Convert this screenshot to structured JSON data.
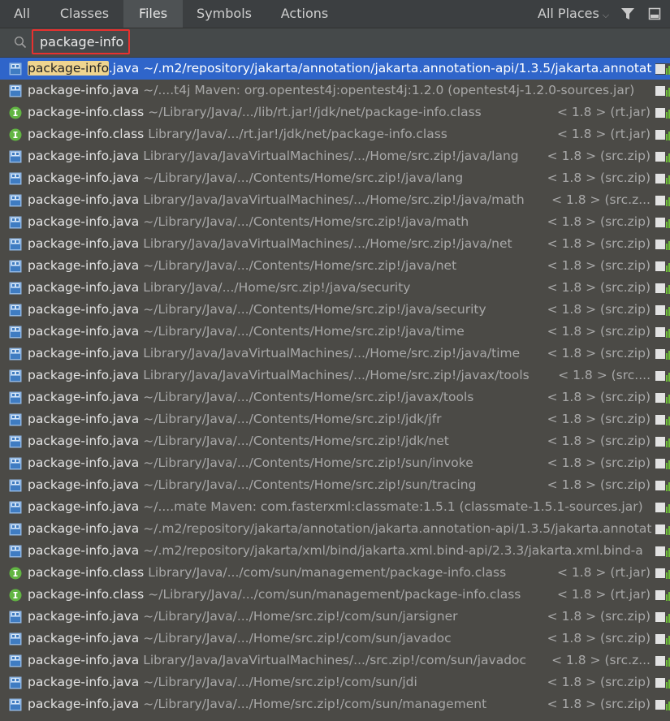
{
  "tabs": [
    {
      "label": "All"
    },
    {
      "label": "Classes"
    },
    {
      "label": "Files"
    },
    {
      "label": "Symbols"
    },
    {
      "label": "Actions"
    }
  ],
  "active_tab": "Files",
  "places": {
    "label": "All Places"
  },
  "search": {
    "value": "package-info"
  },
  "colors": {
    "selection": "#2f65ca",
    "highlight": "#efd48f",
    "search_border": "#e8312f"
  },
  "results": [
    {
      "icon": "java",
      "highlight": "package-info",
      "rest": ".java",
      "path": "~/.m2/repository/jakarta/annotation/jakarta.annotation-api/1.3.5/jakarta.annotat",
      "meta": "",
      "selected": true
    },
    {
      "icon": "java",
      "highlight": "",
      "rest": "package-info.java",
      "path": "~/....t4j   Maven: org.opentest4j:opentest4j:1.2.0 (opentest4j-1.2.0-sources.jar)",
      "meta": ""
    },
    {
      "icon": "class",
      "highlight": "",
      "rest": "package-info.class",
      "path": "~/Library/Java/.../lib/rt.jar!/jdk/net/package-info.class",
      "meta": "< 1.8 > (rt.jar)"
    },
    {
      "icon": "class",
      "highlight": "",
      "rest": "package-info.class",
      "path": "Library/Java/.../rt.jar!/jdk/net/package-info.class",
      "meta": "< 1.8 > (rt.jar)"
    },
    {
      "icon": "java",
      "highlight": "",
      "rest": "package-info.java",
      "path": "Library/Java/JavaVirtualMachines/.../Home/src.zip!/java/lang",
      "meta": "< 1.8 > (src.zip)"
    },
    {
      "icon": "java",
      "highlight": "",
      "rest": "package-info.java",
      "path": "~/Library/Java/.../Contents/Home/src.zip!/java/lang",
      "meta": "< 1.8 > (src.zip)"
    },
    {
      "icon": "java",
      "highlight": "",
      "rest": "package-info.java",
      "path": "Library/Java/JavaVirtualMachines/.../Home/src.zip!/java/math",
      "meta": "< 1.8 > (src.z..."
    },
    {
      "icon": "java",
      "highlight": "",
      "rest": "package-info.java",
      "path": "~/Library/Java/.../Contents/Home/src.zip!/java/math",
      "meta": "< 1.8 > (src.zip)"
    },
    {
      "icon": "java",
      "highlight": "",
      "rest": "package-info.java",
      "path": "Library/Java/JavaVirtualMachines/.../Home/src.zip!/java/net",
      "meta": "< 1.8 > (src.zip)"
    },
    {
      "icon": "java",
      "highlight": "",
      "rest": "package-info.java",
      "path": "~/Library/Java/.../Contents/Home/src.zip!/java/net",
      "meta": "< 1.8 > (src.zip)"
    },
    {
      "icon": "java",
      "highlight": "",
      "rest": "package-info.java",
      "path": "Library/Java/.../Home/src.zip!/java/security",
      "meta": "< 1.8 > (src.zip)"
    },
    {
      "icon": "java",
      "highlight": "",
      "rest": "package-info.java",
      "path": "~/Library/Java/.../Contents/Home/src.zip!/java/security",
      "meta": "< 1.8 > (src.zip)"
    },
    {
      "icon": "java",
      "highlight": "",
      "rest": "package-info.java",
      "path": "~/Library/Java/.../Contents/Home/src.zip!/java/time",
      "meta": "< 1.8 > (src.zip)"
    },
    {
      "icon": "java",
      "highlight": "",
      "rest": "package-info.java",
      "path": "Library/Java/JavaVirtualMachines/.../Home/src.zip!/java/time",
      "meta": "< 1.8 > (src.zip)"
    },
    {
      "icon": "java",
      "highlight": "",
      "rest": "package-info.java",
      "path": "Library/Java/JavaVirtualMachines/.../Home/src.zip!/javax/tools",
      "meta": "< 1.8 > (src...."
    },
    {
      "icon": "java",
      "highlight": "",
      "rest": "package-info.java",
      "path": "~/Library/Java/.../Contents/Home/src.zip!/javax/tools",
      "meta": "< 1.8 > (src.zip)"
    },
    {
      "icon": "java",
      "highlight": "",
      "rest": "package-info.java",
      "path": "~/Library/Java/.../Contents/Home/src.zip!/jdk/jfr",
      "meta": "< 1.8 > (src.zip)"
    },
    {
      "icon": "java",
      "highlight": "",
      "rest": "package-info.java",
      "path": "~/Library/Java/.../Contents/Home/src.zip!/jdk/net",
      "meta": "< 1.8 > (src.zip)"
    },
    {
      "icon": "java",
      "highlight": "",
      "rest": "package-info.java",
      "path": "~/Library/Java/.../Contents/Home/src.zip!/sun/invoke",
      "meta": "< 1.8 > (src.zip)"
    },
    {
      "icon": "java",
      "highlight": "",
      "rest": "package-info.java",
      "path": "~/Library/Java/.../Contents/Home/src.zip!/sun/tracing",
      "meta": "< 1.8 > (src.zip)"
    },
    {
      "icon": "java",
      "highlight": "",
      "rest": "package-info.java",
      "path": "~/....mate   Maven: com.fasterxml:classmate:1.5.1 (classmate-1.5.1-sources.jar)",
      "meta": ""
    },
    {
      "icon": "java",
      "highlight": "",
      "rest": "package-info.java",
      "path": "~/.m2/repository/jakarta/annotation/jakarta.annotation-api/1.3.5/jakarta.annotat",
      "meta": ""
    },
    {
      "icon": "java",
      "highlight": "",
      "rest": "package-info.java",
      "path": "~/.m2/repository/jakarta/xml/bind/jakarta.xml.bind-api/2.3.3/jakarta.xml.bind-a",
      "meta": ""
    },
    {
      "icon": "class",
      "highlight": "",
      "rest": "package-info.class",
      "path": "Library/Java/.../com/sun/management/package-info.class",
      "meta": "< 1.8 > (rt.jar)"
    },
    {
      "icon": "class",
      "highlight": "",
      "rest": "package-info.class",
      "path": "~/Library/Java/.../com/sun/management/package-info.class",
      "meta": "< 1.8 > (rt.jar)"
    },
    {
      "icon": "java",
      "highlight": "",
      "rest": "package-info.java",
      "path": "~/Library/Java/.../Home/src.zip!/com/sun/jarsigner",
      "meta": "< 1.8 > (src.zip)"
    },
    {
      "icon": "java",
      "highlight": "",
      "rest": "package-info.java",
      "path": "~/Library/Java/.../Home/src.zip!/com/sun/javadoc",
      "meta": "< 1.8 > (src.zip)"
    },
    {
      "icon": "java",
      "highlight": "",
      "rest": "package-info.java",
      "path": "Library/Java/JavaVirtualMachines/.../src.zip!/com/sun/javadoc",
      "meta": "< 1.8 > (src.z..."
    },
    {
      "icon": "java",
      "highlight": "",
      "rest": "package-info.java",
      "path": "~/Library/Java/.../Home/src.zip!/com/sun/jdi",
      "meta": "< 1.8 > (src.zip)"
    },
    {
      "icon": "java",
      "highlight": "",
      "rest": "package-info.java",
      "path": "~/Library/Java/.../Home/src.zip!/com/sun/management",
      "meta": "< 1.8 > (src.zip)"
    }
  ]
}
